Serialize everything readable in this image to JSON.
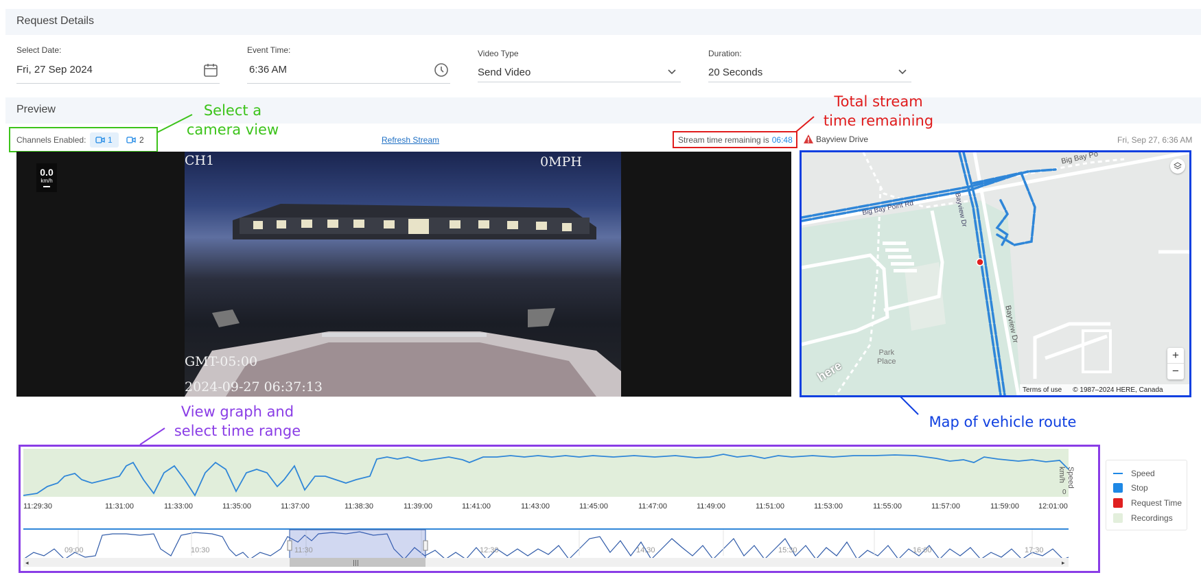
{
  "request_details": {
    "title": "Request Details",
    "date_label": "Select Date:",
    "date_value": "Fri, 27 Sep 2024",
    "time_label": "Event Time:",
    "time_value": "6:36 AM",
    "video_type_label": "Video Type",
    "video_type_value": "Send Video",
    "duration_label": "Duration:",
    "duration_value": "20 Seconds"
  },
  "preview": {
    "title": "Preview",
    "channels_label": "Channels Enabled:",
    "channels": [
      "1",
      "2"
    ],
    "refresh_label": "Refresh Stream",
    "stream_text": "Stream time remaining is",
    "stream_time": "06:48",
    "location": "Bayview Drive",
    "datetime": "Fri, Sep 27, 6:36 AM"
  },
  "video": {
    "speed_value": "0.0",
    "speed_unit": "km/h",
    "channel_overlay": "CH1",
    "mph_overlay": "0MPH",
    "tz_overlay": "GMT-05:00",
    "timestamp_overlay": "2024-09-27 06:37:13"
  },
  "map": {
    "labels": {
      "big_bay": "Big Bay Po",
      "big_bay_road": "Big Bay Point Rd",
      "bayview": "Bayview Dr",
      "bayview_vertical": "Bayview Dr",
      "park": "Park\nPlace",
      "here_logo": "here"
    },
    "terms": "Terms of use",
    "copyright": "© 1987–2024 HERE, Canada",
    "zoom_in": "+",
    "zoom_out": "−"
  },
  "graph": {
    "axis_title": "Speed\nkm/h",
    "zero_label": "0",
    "x_ticks": [
      "11:29:30",
      "11:31:00",
      "11:33:00",
      "11:35:00",
      "11:37:00",
      "11:38:30",
      "11:39:00",
      "11:41:00",
      "11:43:00",
      "11:45:00",
      "11:47:00",
      "11:49:00",
      "11:51:00",
      "11:53:00",
      "11:55:00",
      "11:57:00",
      "11:59:00",
      "12:01:00"
    ],
    "overview_ticks": [
      "09:00",
      "10:30",
      "11:30",
      "12:30",
      "14:30",
      "15:30",
      "16:00",
      "17:30"
    ],
    "legend": [
      {
        "label": "Speed",
        "color": "#1e88e5"
      },
      {
        "label": "Stop",
        "color": "#1e88e5"
      },
      {
        "label": "Request Time",
        "color": "#e02020"
      },
      {
        "label": "Recordings",
        "color": "#e3efdc"
      }
    ]
  },
  "annotations": {
    "camera": "Select a\ncamera view",
    "stream": "Total stream\ntime remaining",
    "graph": "View graph and\nselect time range",
    "map": "Map of vehicle route",
    "green": "#3cc31a",
    "red": "#e01b1b",
    "purple": "#8a3de6",
    "blue": "#1040e0"
  }
}
